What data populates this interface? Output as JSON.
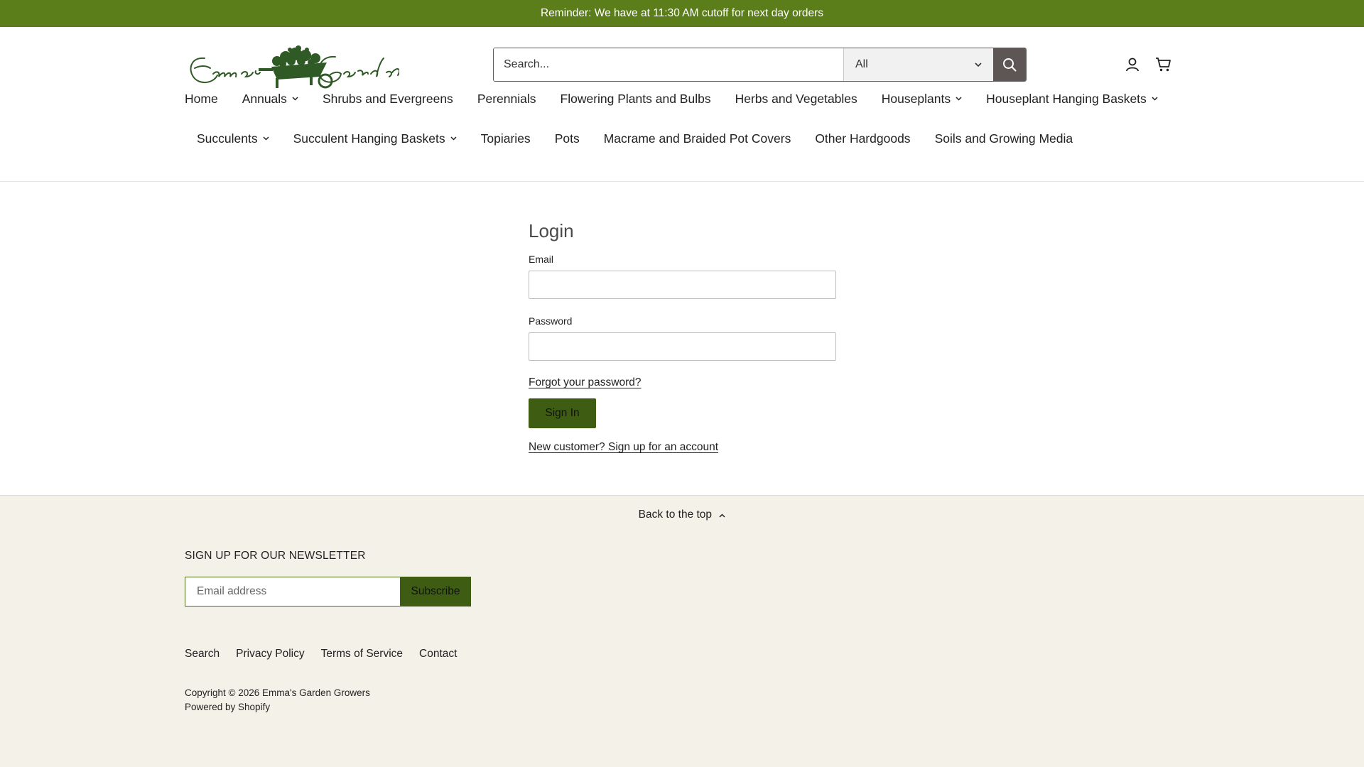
{
  "announcement": "Reminder: We have at 11:30 AM cutoff for next day orders",
  "logo": {
    "text": "Emma's Garden",
    "icon": "wheelbarrow-logo"
  },
  "search": {
    "placeholder": "Search...",
    "category": "All",
    "submit_icon": "search-icon"
  },
  "header_icons": {
    "account": "user-icon",
    "cart": "cart-icon"
  },
  "nav": {
    "row1": [
      {
        "label": "Home",
        "dropdown": false
      },
      {
        "label": "Annuals",
        "dropdown": true
      },
      {
        "label": "Shrubs and Evergreens",
        "dropdown": false
      },
      {
        "label": "Perennials",
        "dropdown": false
      },
      {
        "label": "Flowering Plants and Bulbs",
        "dropdown": false
      },
      {
        "label": "Herbs and Vegetables",
        "dropdown": false
      },
      {
        "label": "Houseplants",
        "dropdown": true
      },
      {
        "label": "Houseplant Hanging Baskets",
        "dropdown": true
      }
    ],
    "row2": [
      {
        "label": "Succulents",
        "dropdown": true
      },
      {
        "label": "Succulent Hanging Baskets",
        "dropdown": true
      },
      {
        "label": "Topiaries",
        "dropdown": false
      },
      {
        "label": "Pots",
        "dropdown": false
      },
      {
        "label": "Macrame and Braided Pot Covers",
        "dropdown": false
      },
      {
        "label": "Other Hardgoods",
        "dropdown": false
      },
      {
        "label": "Soils and Growing Media",
        "dropdown": false
      }
    ]
  },
  "login": {
    "title": "Login",
    "email_label": "Email",
    "email_value": "",
    "password_label": "Password",
    "password_value": "",
    "forgot": "Forgot your password?",
    "submit": "Sign In",
    "signup": "New customer? Sign up for an account"
  },
  "footer": {
    "back_to_top": "Back to the top",
    "newsletter_title": "SIGN UP FOR OUR NEWSLETTER",
    "newsletter_placeholder": "Email address",
    "subscribe": "Subscribe",
    "links": [
      "Search",
      "Privacy Policy",
      "Terms of Service",
      "Contact"
    ],
    "copyright": "Copyright © 2026 Emma's Garden Growers",
    "powered": "Powered by Shopify"
  },
  "colors": {
    "announcement_bg": "#5b7d1a",
    "button_bg": "#3e5d12",
    "search_button_bg": "#5e5654",
    "footer_bg": "#f4f1e8"
  }
}
